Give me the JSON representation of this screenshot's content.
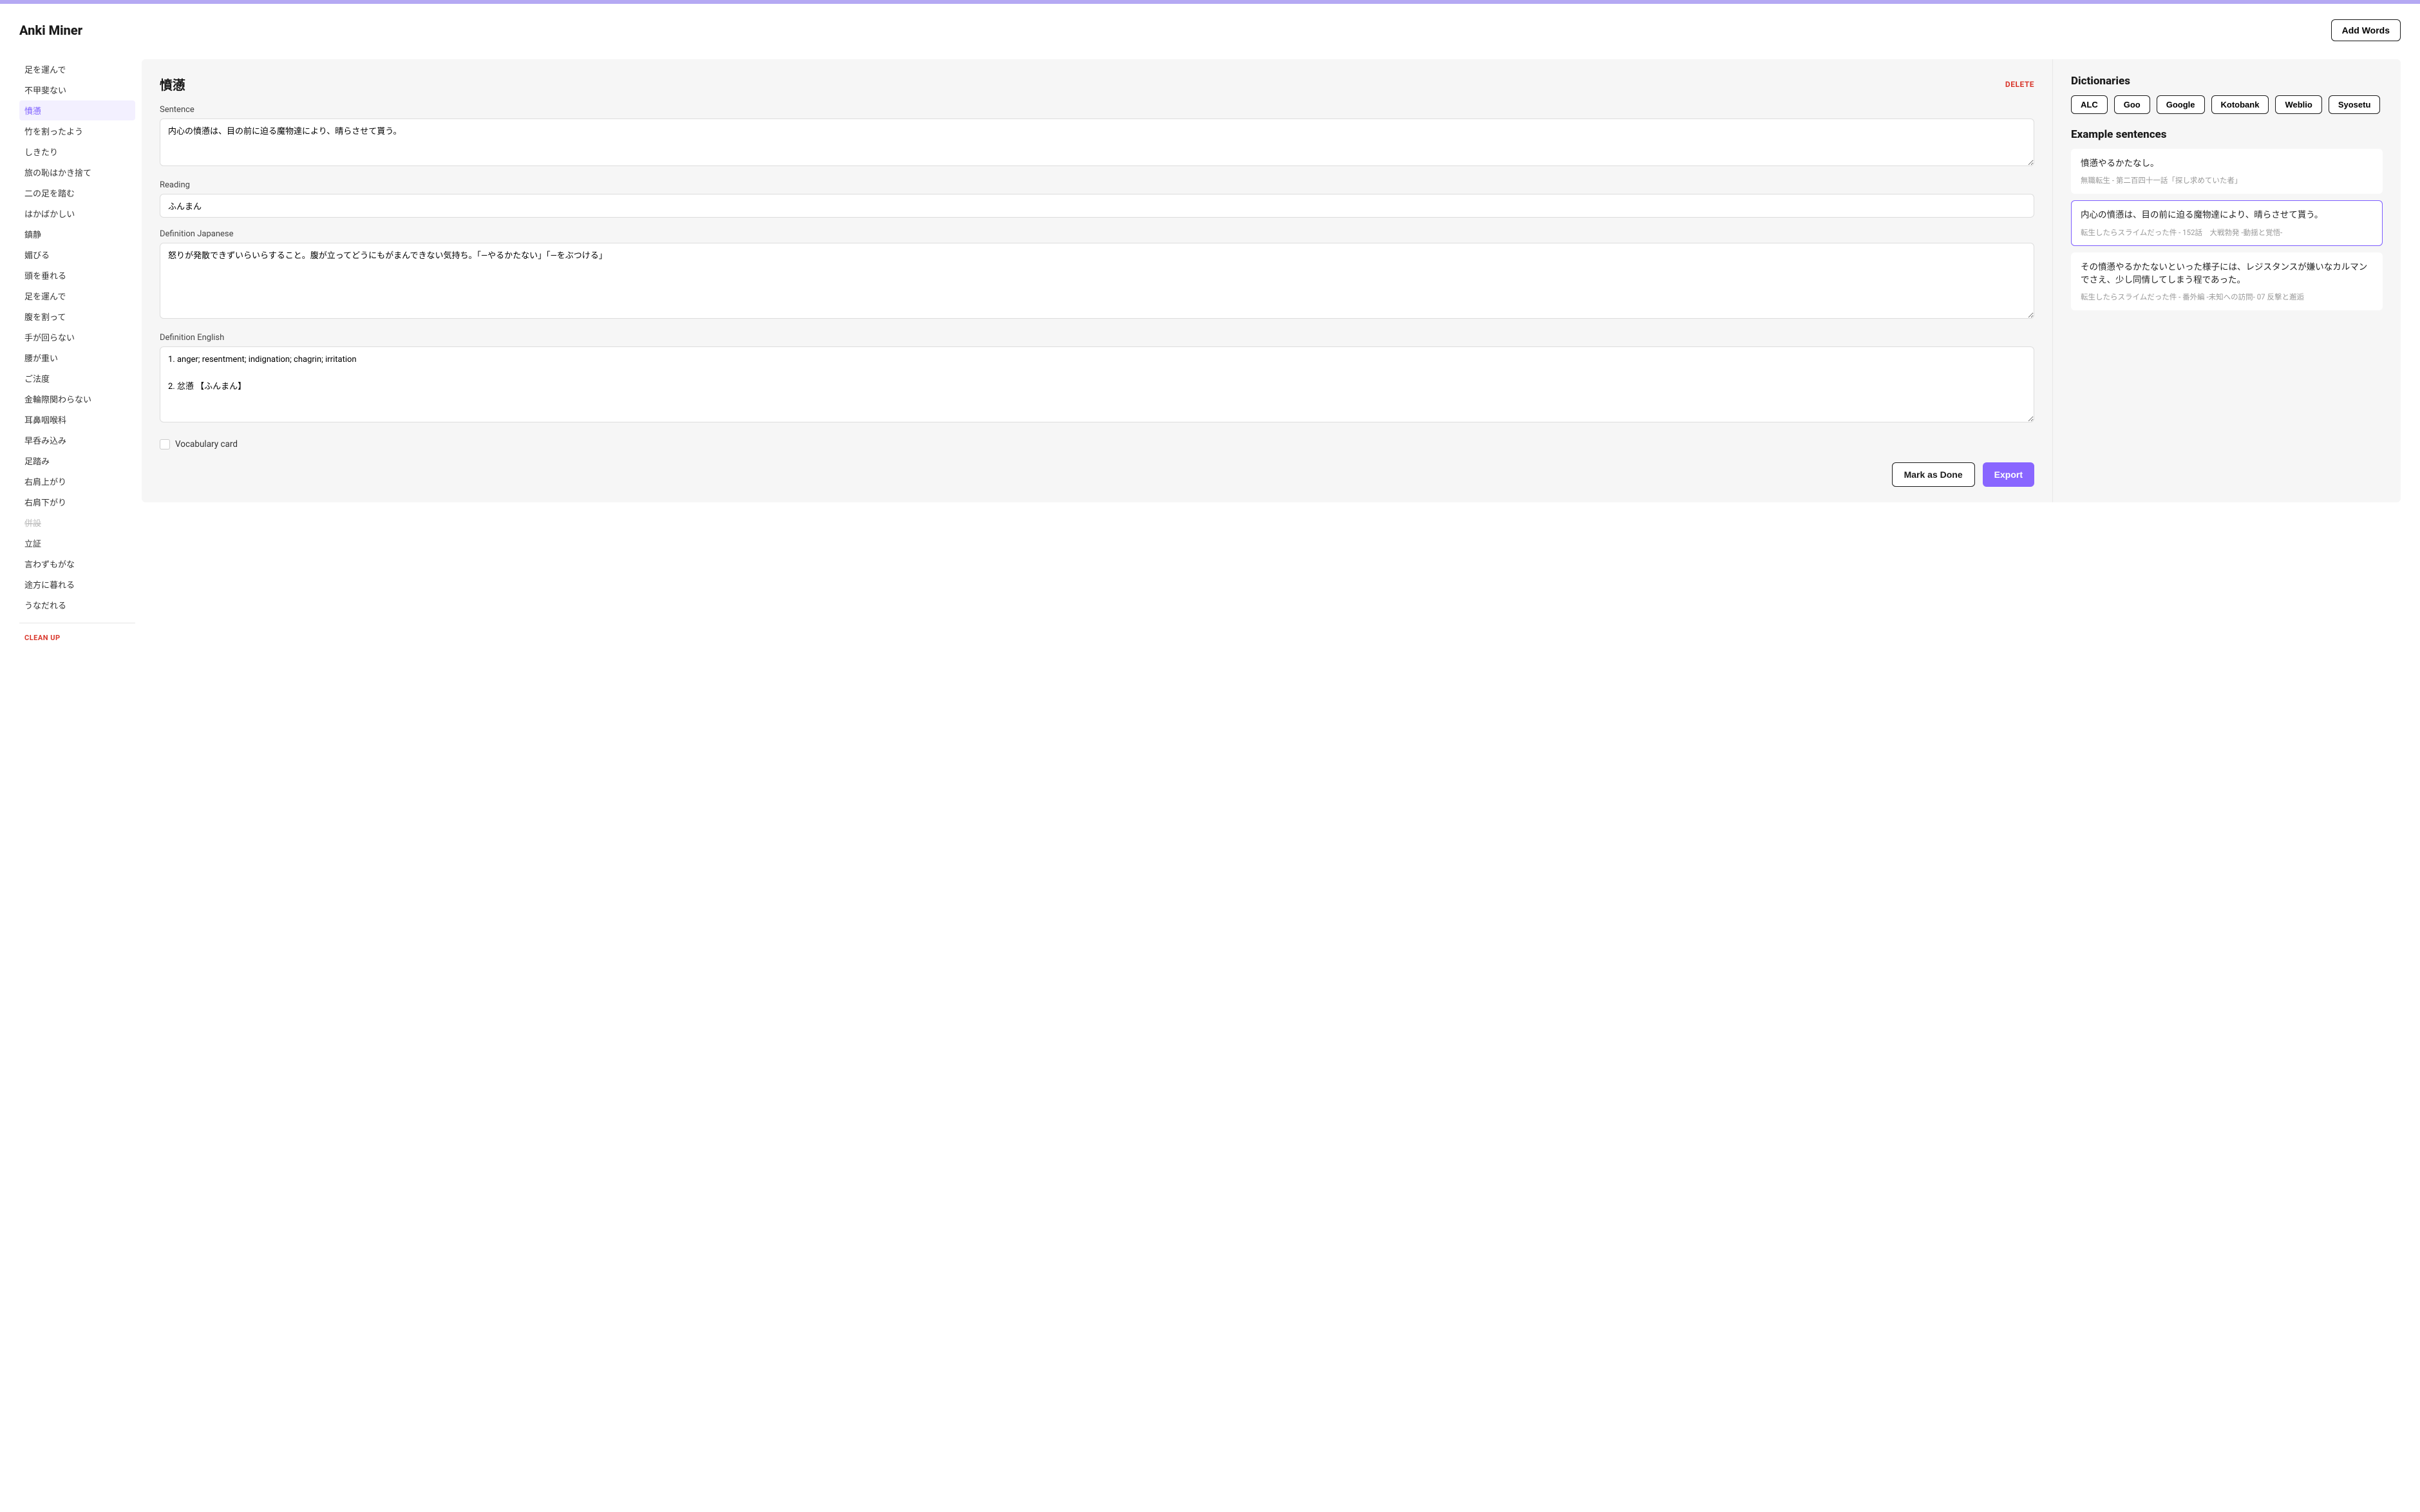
{
  "header": {
    "title": "Anki Miner",
    "add_words": "Add Words"
  },
  "sidebar": {
    "items": [
      {
        "label": "足を運んで",
        "state": "normal"
      },
      {
        "label": "不甲斐ない",
        "state": "normal"
      },
      {
        "label": "憤懣",
        "state": "active"
      },
      {
        "label": "竹を割ったよう",
        "state": "normal"
      },
      {
        "label": "しきたり",
        "state": "normal"
      },
      {
        "label": "旅の恥はかき捨て",
        "state": "normal"
      },
      {
        "label": "二の足を踏む",
        "state": "normal"
      },
      {
        "label": "はかばかしい",
        "state": "normal"
      },
      {
        "label": "鎮静",
        "state": "normal"
      },
      {
        "label": "媚びる",
        "state": "normal"
      },
      {
        "label": "頭を垂れる",
        "state": "normal"
      },
      {
        "label": "足を運んで",
        "state": "normal"
      },
      {
        "label": "腹を割って",
        "state": "normal"
      },
      {
        "label": "手が回らない",
        "state": "normal"
      },
      {
        "label": "腰が重い",
        "state": "normal"
      },
      {
        "label": "ご法度",
        "state": "normal"
      },
      {
        "label": "金輪際関わらない",
        "state": "normal"
      },
      {
        "label": "耳鼻咽喉科",
        "state": "normal"
      },
      {
        "label": "早呑み込み",
        "state": "normal"
      },
      {
        "label": "足踏み",
        "state": "normal"
      },
      {
        "label": "右肩上がり",
        "state": "normal"
      },
      {
        "label": "右肩下がり",
        "state": "normal"
      },
      {
        "label": "併設",
        "state": "done"
      },
      {
        "label": "立証",
        "state": "normal"
      },
      {
        "label": "言わずもがな",
        "state": "normal"
      },
      {
        "label": "途方に暮れる",
        "state": "normal"
      },
      {
        "label": "うなだれる",
        "state": "normal"
      }
    ],
    "cleanup": "CLEAN UP"
  },
  "edit": {
    "headword": "憤懣",
    "delete": "DELETE",
    "sentence_label": "Sentence",
    "sentence_value": "内心の憤懣は、目の前に迫る魔物達により、晴らさせて貰う。",
    "reading_label": "Reading",
    "reading_value": "ふんまん",
    "defjp_label": "Definition Japanese",
    "defjp_value": "怒りが発散できずいらいらすること。腹が立ってどうにもがまんできない気持ち。「―やるかたない」「―をぶつける」",
    "defen_label": "Definition English",
    "defen_value": "1. anger; resentment; indignation; chagrin; irritation\n\n2. 忿懣 【ふんまん】",
    "vocab_checkbox_label": "Vocabulary card",
    "mark_done": "Mark as Done",
    "export": "Export"
  },
  "right": {
    "dict_title": "Dictionaries",
    "dictionaries": [
      "ALC",
      "Goo",
      "Google",
      "Kotobank",
      "Weblio",
      "Syosetu"
    ],
    "examples_title": "Example sentences",
    "examples": [
      {
        "sentence": "憤懣やるかたなし。",
        "source": "無職転生 - 第二百四十一話「探し求めていた者」",
        "selected": false
      },
      {
        "sentence": "内心の憤懣は、目の前に迫る魔物達により、晴らさせて貰う。",
        "source": "転生したらスライムだった件 - 152話　大戦勃発 -動揺と覚悟-",
        "selected": true
      },
      {
        "sentence": "その憤懣やるかたないといった様子には、レジスタンスが嫌いなカルマンでさえ、少し同情してしまう程であった。",
        "source": "転生したらスライムだった件 - 番外編 -未知への訪問- 07 反撃と邂逅",
        "selected": false
      }
    ]
  }
}
